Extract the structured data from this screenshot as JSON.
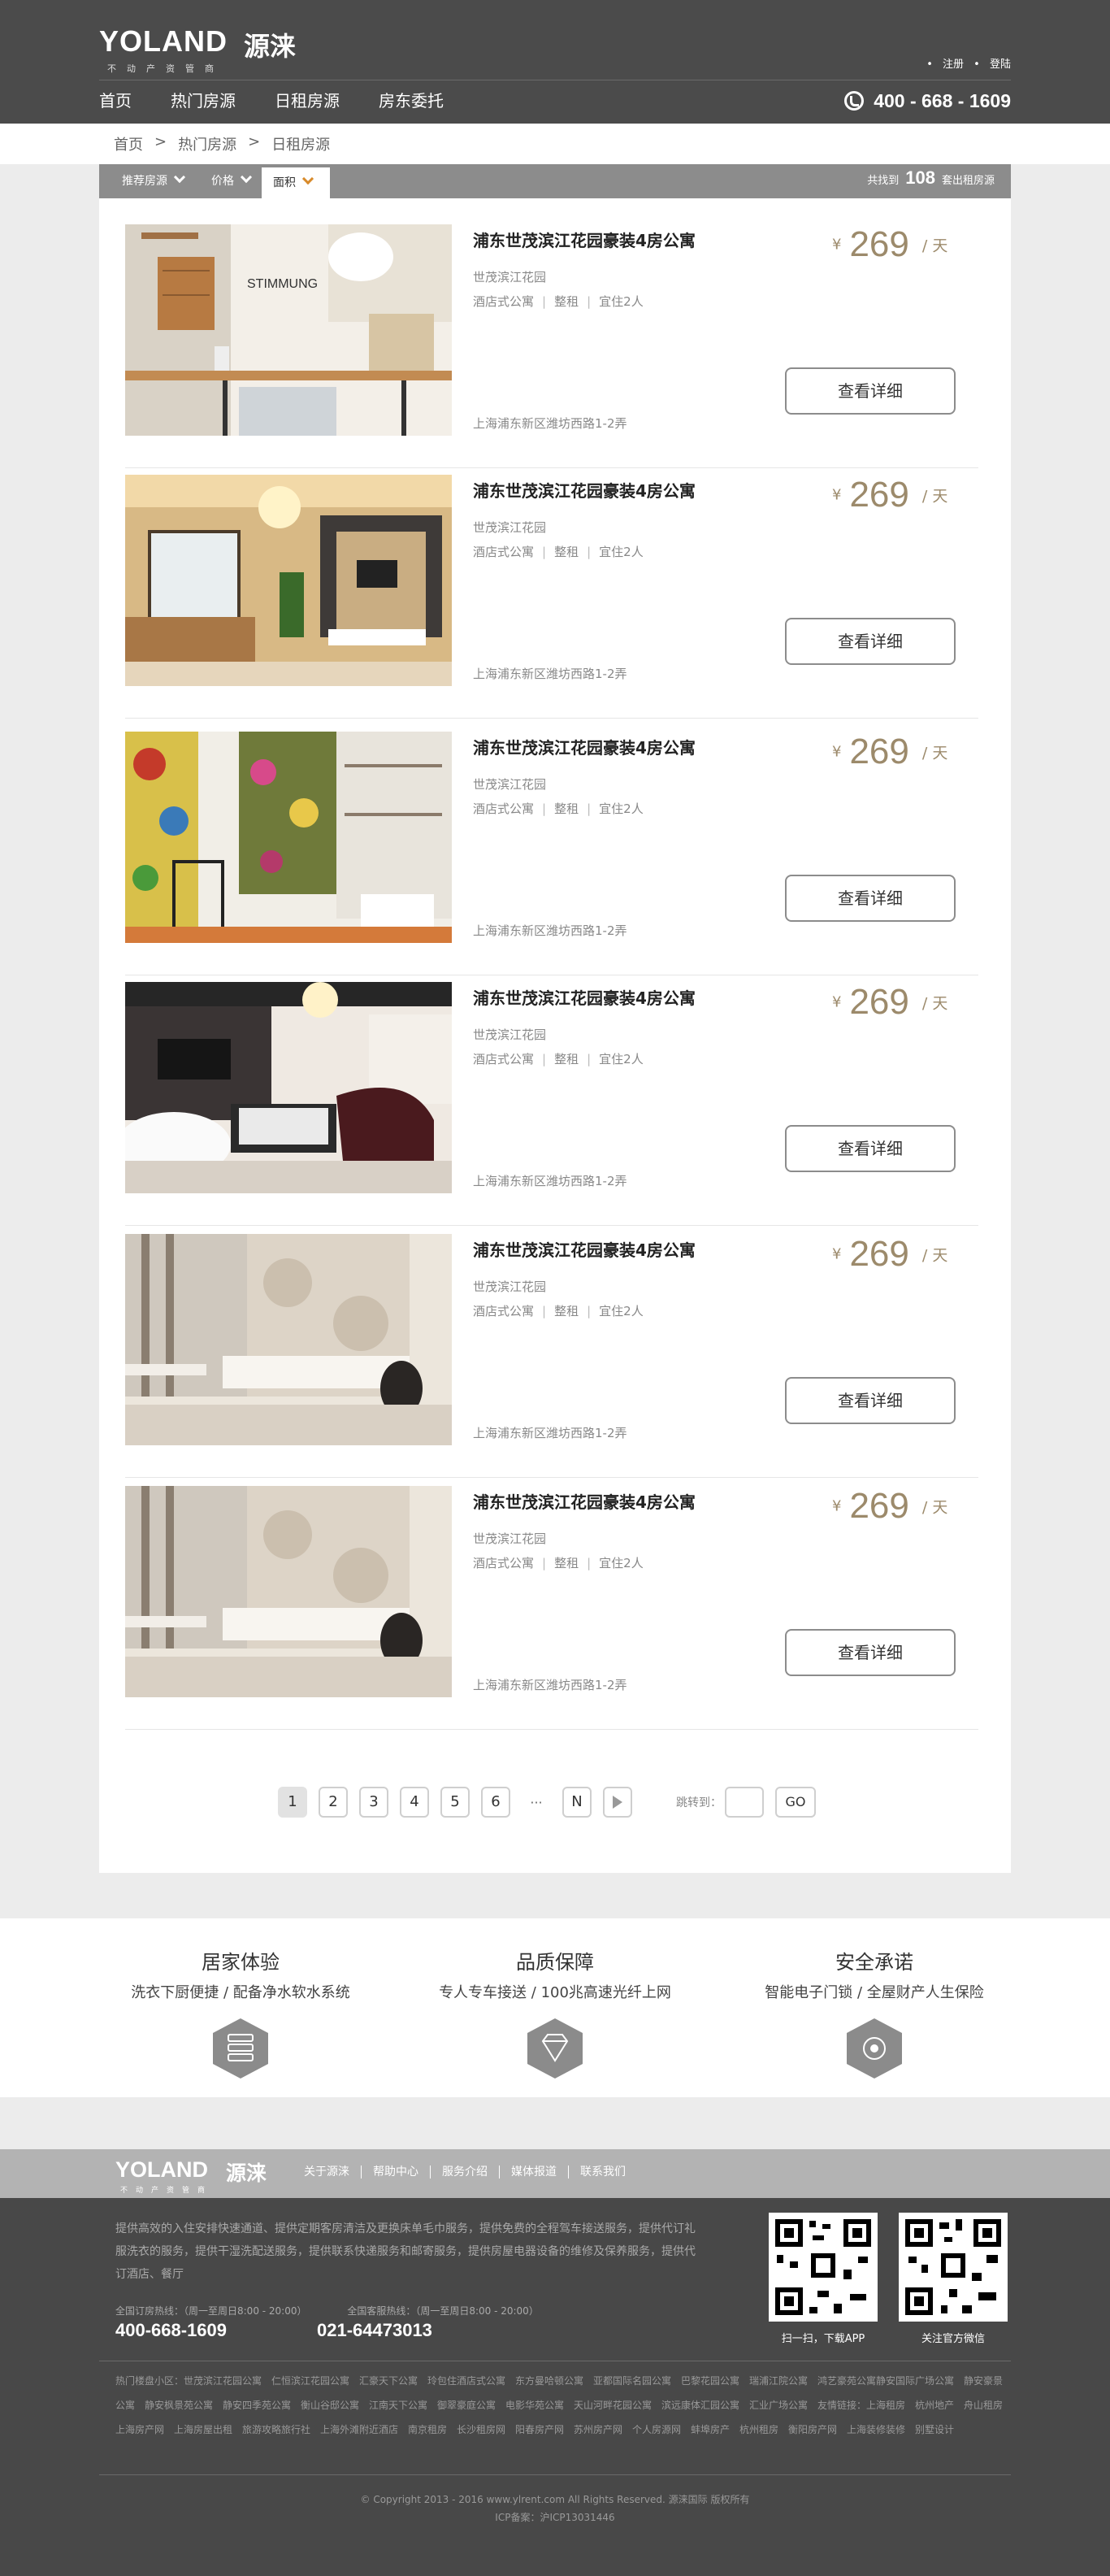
{
  "brand": {
    "name_en": "YOLAND",
    "name_cn": "源涞",
    "tagline": "不动产资管商"
  },
  "top_links": {
    "register": "注册",
    "login": "登陆"
  },
  "nav": {
    "items": [
      "首页",
      "热门房源",
      "日租房源",
      "房东委托"
    ]
  },
  "hotline": "400 - 668 - 1609",
  "breadcrumb": [
    "首页",
    "热门房源",
    "日租房源"
  ],
  "filters": {
    "recommended": "推荐房源",
    "price": "价格",
    "area": "面积",
    "count_prefix": "共找到",
    "count": "108",
    "count_suffix": "套出租房源"
  },
  "listings": [
    {
      "title": "浦东世茂滨江花园豪装4房公寓",
      "community": "世茂滨江花园",
      "type": "酒店式公寓",
      "rent": "整租",
      "capacity": "宜住2人",
      "address": "上海浦东新区潍坊西路1-2弄",
      "currency": "¥",
      "price": "269",
      "unit": "/ 天",
      "button": "查看详细"
    },
    {
      "title": "浦东世茂滨江花园豪装4房公寓",
      "community": "世茂滨江花园",
      "type": "酒店式公寓",
      "rent": "整租",
      "capacity": "宜住2人",
      "address": "上海浦东新区潍坊西路1-2弄",
      "currency": "¥",
      "price": "269",
      "unit": "/ 天",
      "button": "查看详细"
    },
    {
      "title": "浦东世茂滨江花园豪装4房公寓",
      "community": "世茂滨江花园",
      "type": "酒店式公寓",
      "rent": "整租",
      "capacity": "宜住2人",
      "address": "上海浦东新区潍坊西路1-2弄",
      "currency": "¥",
      "price": "269",
      "unit": "/ 天",
      "button": "查看详细"
    },
    {
      "title": "浦东世茂滨江花园豪装4房公寓",
      "community": "世茂滨江花园",
      "type": "酒店式公寓",
      "rent": "整租",
      "capacity": "宜住2人",
      "address": "上海浦东新区潍坊西路1-2弄",
      "currency": "¥",
      "price": "269",
      "unit": "/ 天",
      "button": "查看详细"
    },
    {
      "title": "浦东世茂滨江花园豪装4房公寓",
      "community": "世茂滨江花园",
      "type": "酒店式公寓",
      "rent": "整租",
      "capacity": "宜住2人",
      "address": "上海浦东新区潍坊西路1-2弄",
      "currency": "¥",
      "price": "269",
      "unit": "/ 天",
      "button": "查看详细"
    },
    {
      "title": "浦东世茂滨江花园豪装4房公寓",
      "community": "世茂滨江花园",
      "type": "酒店式公寓",
      "rent": "整租",
      "capacity": "宜住2人",
      "address": "上海浦东新区潍坊西路1-2弄",
      "currency": "¥",
      "price": "269",
      "unit": "/ 天",
      "button": "查看详细"
    }
  ],
  "pagination": {
    "pages": [
      "1",
      "2",
      "3",
      "4",
      "5",
      "6"
    ],
    "ellipsis": "···",
    "next": "N",
    "jump_label": "跳转到：",
    "go": "GO"
  },
  "features": [
    {
      "title": "居家体验",
      "desc": "洗衣下厨便捷 / 配备净水软水系统",
      "icon": "server-stack-icon"
    },
    {
      "title": "品质保障",
      "desc": "专人专车接送 / 100兆高速光纤上网",
      "icon": "diamond-icon"
    },
    {
      "title": "安全承诺",
      "desc": "智能电子门锁 / 全屋财产人生保险",
      "icon": "gear-icon"
    }
  ],
  "footer": {
    "links": [
      "关于源涞",
      "帮助中心",
      "服务介绍",
      "媒体报道",
      "联系我们"
    ],
    "about": "提供高效的入住安排快速通道、提供定期客房清洁及更换床单毛巾服务，提供免费的全程驾车接送服务，提供代订礼服洗衣的服务，提供干湿洗配送服务，提供联系快递服务和邮寄服务，提供房屋电器设备的维修及保养服务，提供代订酒店、餐厅",
    "hotline_label": "全国订房热线：（周一至周日8:00 - 20:00）",
    "hotline": "400-668-1609",
    "service_label": "全国客服热线：（周一至周日8:00 - 20:00）",
    "service": "021-64473013",
    "qr_app": "扫一扫，下载APP",
    "qr_wechat": "关注官方微信",
    "community": "热门楼盘小区：世茂滨江花园公寓　仁恒滨江花园公寓　汇豪天下公寓　玲包住酒店式公寓　东方曼哈顿公寓　亚都国际名园公寓　巴黎花园公寓　瑞浦江院公寓　鸿艺豪苑公寓静安国际广场公寓　静安豪景公寓　静安枫景苑公寓　静安四季苑公寓　衡山谷邸公寓　江南天下公寓　御翠豪庭公寓　电影华苑公寓　天山河畔花园公寓　滨远康体汇园公寓　汇业广场公寓　友情链接：上海租房　杭州地产　舟山租房　上海房产网　上海房屋出租　旅游攻略旅行社　上海外滩附近酒店　南京租房　长沙租房网　阳春房产网　苏州房产网　个人房源网　蚌埠房产　杭州租房　衡阳房产网　上海装修装修　别墅设计",
    "copyright": "© Copyright 2013 - 2016 www.ylrent.com All Rights Reserved. 源涞国际 版权所有",
    "icp": "ICP备案：沪ICP13031446"
  },
  "colors": {
    "header_bg": "#4b4b4b",
    "accent_gold": "#9c8a6b",
    "filter_bar": "#8c8c8c",
    "footer_bg": "#484848"
  }
}
